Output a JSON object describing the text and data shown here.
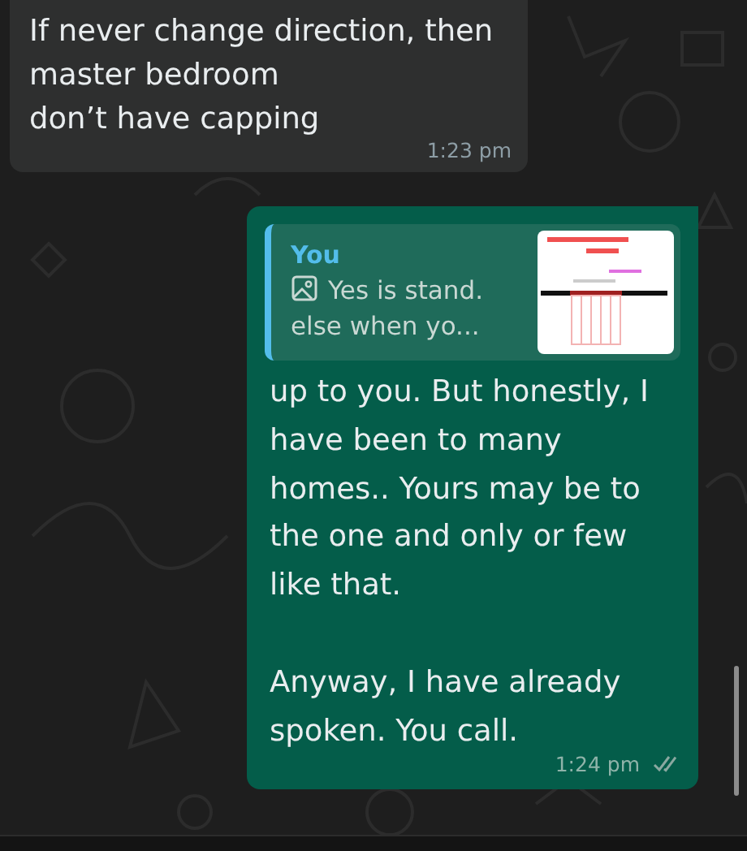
{
  "messages": [
    {
      "kind": "incoming",
      "text": "If never change direction, then\nmaster bedroom\ndon’t have capping",
      "time": "1:23 pm"
    },
    {
      "kind": "outgoing",
      "quote": {
        "author": "You",
        "lines": [
          "Yes is stand.",
          "else when yo..."
        ]
      },
      "text": "up to you. But honestly, I have been to many homes.. Yours may be to the one and only or few like that.\n\nAnyway, I have already spoken. You call.",
      "time": "1:24 pm",
      "read": false
    }
  ]
}
